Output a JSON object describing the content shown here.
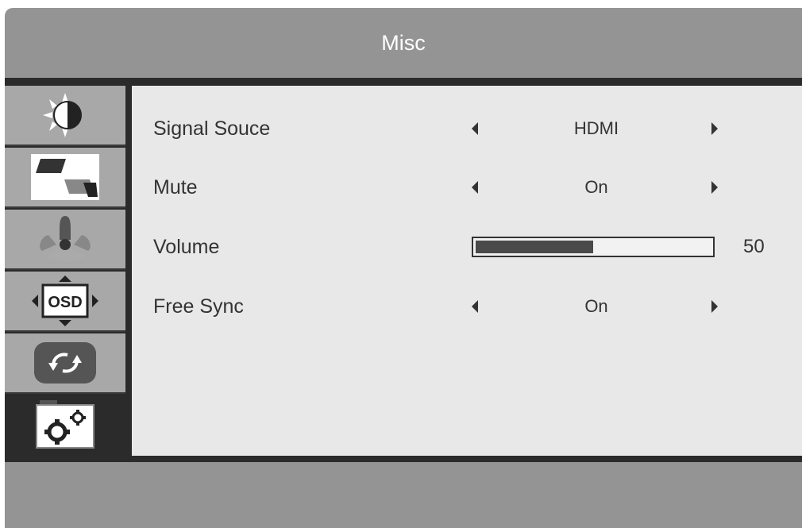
{
  "title": "Misc",
  "sidebar": {
    "items": [
      {
        "icon": "brightness-contrast-icon",
        "active": false
      },
      {
        "icon": "image-setup-icon",
        "active": false
      },
      {
        "icon": "color-icon",
        "active": false
      },
      {
        "icon": "osd-setup-icon",
        "label": "OSD",
        "active": false
      },
      {
        "icon": "reset-icon",
        "active": false
      },
      {
        "icon": "misc-gears-icon",
        "active": true
      }
    ]
  },
  "settings": [
    {
      "label": "Signal Souce",
      "value": "HDMI"
    },
    {
      "label": "Mute",
      "value": "On"
    },
    {
      "label": "Volume",
      "value": "50",
      "level": 0.5
    },
    {
      "label": "Free Sync",
      "value": "On"
    }
  ],
  "colors": {
    "frame": "#949494",
    "panel": "#e8e8e8",
    "dark": "#2b2b2b",
    "sidebar": "#a8a8a8"
  }
}
